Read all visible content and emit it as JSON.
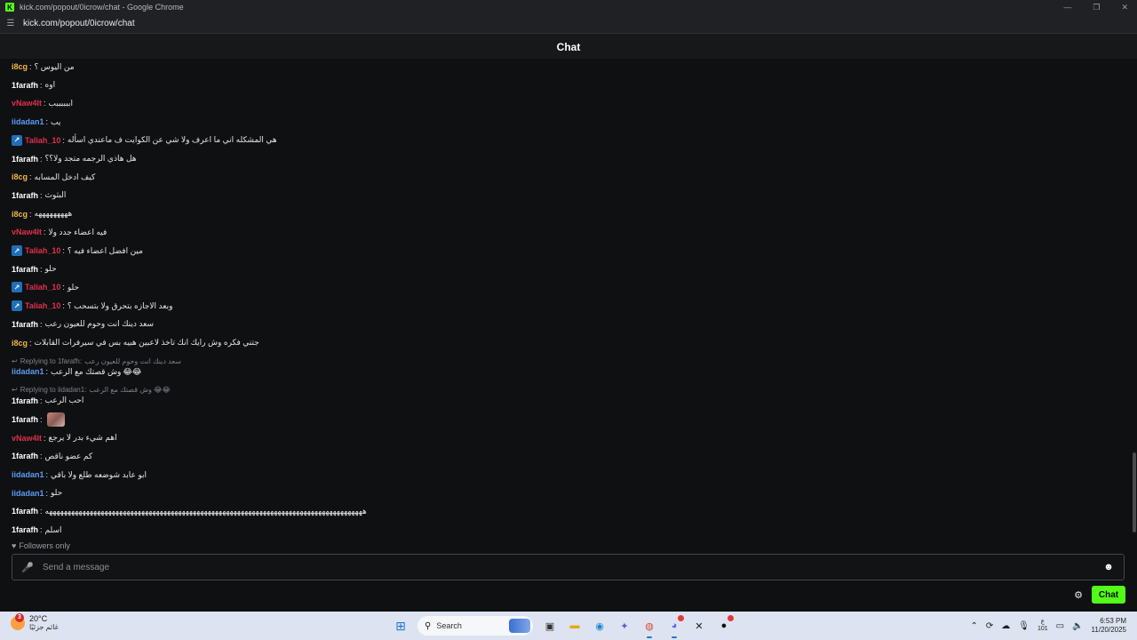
{
  "window": {
    "title": "kick.com/popout/0icrow/chat - Google Chrome",
    "url": "kick.com/popout/0icrow/chat",
    "favicon_letter": "K"
  },
  "header": {
    "title": "Chat"
  },
  "messages": [
    {
      "user": "i8cg",
      "color": "#f2b84b",
      "text": "من اليوس ؟",
      "badge": false
    },
    {
      "user": "1farafh",
      "color": "#ffffff",
      "text": "اوه",
      "badge": false
    },
    {
      "user": "vNaw4lt",
      "color": "#e0304b",
      "text": "اببببببب",
      "badge": false
    },
    {
      "user": "iidadan1",
      "color": "#5c9cf0",
      "text": "يب",
      "badge": false
    },
    {
      "user": "Taliah_10",
      "color": "#e0304b",
      "text": "هي المشكله اني ما اعرف ولا شي عن الكوايت ف ماعندي اسأله",
      "badge": true
    },
    {
      "user": "1farafh",
      "color": "#ffffff",
      "text": "هل هاذي الرجمه متجد ولا؟؟",
      "badge": false
    },
    {
      "user": "i8cg",
      "color": "#f2b84b",
      "text": "كيف ادخل المسابه",
      "badge": false
    },
    {
      "user": "1farafh",
      "color": "#ffffff",
      "text": "البثوث",
      "badge": false
    },
    {
      "user": "i8cg",
      "color": "#f2b84b",
      "text": "هههههههههه",
      "badge": false
    },
    {
      "user": "vNaw4lt",
      "color": "#e0304b",
      "text": "فيه اعضاء جدد ولا",
      "badge": false
    },
    {
      "user": "Taliah_10",
      "color": "#e0304b",
      "text": "مين افضل اعضاء فيه ؟",
      "badge": true
    },
    {
      "user": "1farafh",
      "color": "#ffffff",
      "text": "حلو",
      "badge": false
    },
    {
      "user": "Taliah_10",
      "color": "#e0304b",
      "text": "حلو",
      "badge": true
    },
    {
      "user": "Taliah_10",
      "color": "#e0304b",
      "text": "وبعد الاجازه بتحرق ولا بتسحب ؟",
      "badge": true
    },
    {
      "user": "1farafh",
      "color": "#ffffff",
      "text": "سعد دينك انت وحوم للعيون رعب",
      "badge": false
    },
    {
      "user": "i8cg",
      "color": "#f2b84b",
      "text": "جتني فكره وش رايك انك تاخذ لاعبين هبيه بس في سيرفرات القابلات",
      "badge": false
    },
    {
      "reply": "Replying to 1farafh:",
      "reply_text": "سعد دينك انت وحوم للعيون رعب"
    },
    {
      "user": "iidadan1",
      "color": "#5c9cf0",
      "text": "وش قصتك مع الرعب",
      "badge": false,
      "emoji": "😂😂"
    },
    {
      "reply": "Replying to iidadan1:",
      "reply_text": "وش قصتك مع الرعب 😂😂"
    },
    {
      "user": "1farafh",
      "color": "#ffffff",
      "text": "احب الرعب",
      "badge": false
    },
    {
      "user": "1farafh",
      "color": "#ffffff",
      "text": "",
      "badge": false,
      "image": true
    },
    {
      "user": "vNaw4lt",
      "color": "#e0304b",
      "text": "اهم شيء بدر لا يرجع",
      "badge": false
    },
    {
      "user": "1farafh",
      "color": "#ffffff",
      "text": "كم عضو ناقص",
      "badge": false
    },
    {
      "user": "iidadan1",
      "color": "#5c9cf0",
      "text": "ابو عابد شوضعه طلع ولا باقي",
      "badge": false
    },
    {
      "user": "iidadan1",
      "color": "#5c9cf0",
      "text": "حلو",
      "badge": false
    },
    {
      "user": "1farafh",
      "color": "#ffffff",
      "text": "ههههههههههههههههههههههههههههههههههههههههههههههههههههههههههههههههههههههههههههههههههههههه",
      "badge": false
    },
    {
      "user": "1farafh",
      "color": "#ffffff",
      "text": "اسلم",
      "badge": false
    }
  ],
  "footer": {
    "followers_only": "Followers only",
    "input_placeholder": "Send a message",
    "chat_button": "Chat"
  },
  "taskbar": {
    "weather_temp": "20°C",
    "weather_cond": "غائم جزئيًا",
    "weather_badge": "3",
    "search_label": "Search",
    "lang_top": "ع",
    "lang_bottom": "101",
    "time": "6:53 PM",
    "date": "11/20/2025"
  }
}
